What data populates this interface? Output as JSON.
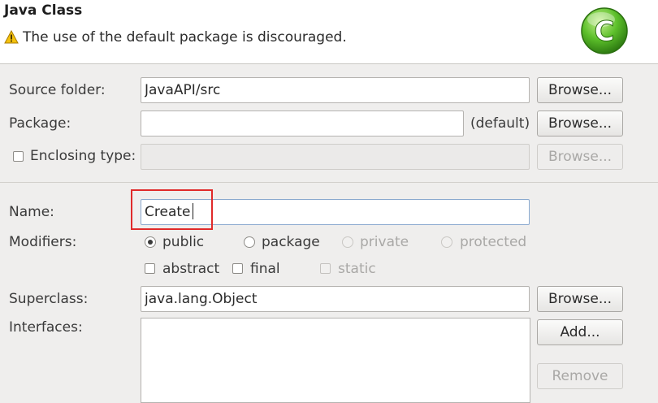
{
  "header": {
    "title": "Java Class",
    "warning": "The use of the default package is discouraged.",
    "warning_icon": "warning-icon",
    "logo_icon": "java-class-logo-icon",
    "logo_letter": "C"
  },
  "source_folder": {
    "label": "Source folder:",
    "value": "JavaAPI/src",
    "button": "Browse..."
  },
  "package": {
    "label": "Package:",
    "value": "",
    "suffix": "(default)",
    "button": "Browse..."
  },
  "enclosing": {
    "label": "Enclosing type:",
    "checked": false,
    "value": "",
    "button": "Browse..."
  },
  "name": {
    "label": "Name:",
    "value": "Create"
  },
  "modifiers": {
    "label": "Modifiers:",
    "options": [
      "public",
      "package",
      "private",
      "protected"
    ],
    "selected": "public",
    "flags": [
      "abstract",
      "final",
      "static"
    ]
  },
  "superclass": {
    "label": "Superclass:",
    "value": "java.lang.Object",
    "button": "Browse..."
  },
  "interfaces": {
    "label": "Interfaces:",
    "add_button": "Add...",
    "remove_button": "Remove"
  },
  "colors": {
    "highlight": "#e02a2a",
    "logo_green": "#5cbf2a",
    "warning": "#f2b600"
  }
}
